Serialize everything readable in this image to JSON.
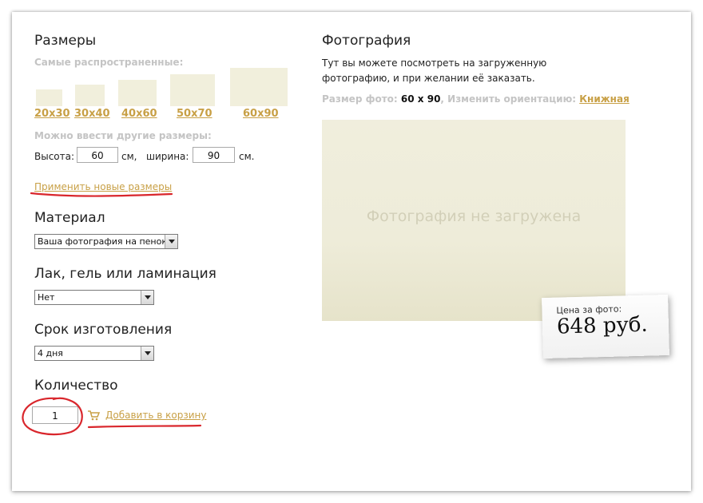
{
  "sizes": {
    "title": "Размеры",
    "common_label": "Самые распространенные:",
    "options": [
      "20x30",
      "30x40",
      "40x60",
      "50x70",
      "60x90"
    ],
    "custom_label": "Можно ввести другие размеры:",
    "height_label": "Высота:",
    "height_value": "60",
    "unit1": "см,",
    "width_label": "ширина:",
    "width_value": "90",
    "unit2": "см.",
    "apply_link": "Применить новые размеры"
  },
  "material": {
    "title": "Материал",
    "selected": "Ваша фотография на пенокартоне"
  },
  "coating": {
    "title": "Лак, гель или ламинация",
    "selected": "Нет"
  },
  "term": {
    "title": "Срок изготовления",
    "selected": "4 дня"
  },
  "quantity": {
    "title": "Количество",
    "value": "1",
    "add_to_cart": "Добавить в корзину"
  },
  "photo": {
    "title": "Фотография",
    "description": "Тут вы можете посмотреть на загруженную фотографию, и при желании её заказать.",
    "size_label": "Размер фото:",
    "size_value": "60 x 90",
    "orientation_label": ", Изменить ориентацию:",
    "orientation_link": "Книжная",
    "placeholder": "Фотография не загружена"
  },
  "price": {
    "label": "Цена за фото:",
    "value": "648 руб."
  },
  "colors": {
    "accent_gold": "#c8a046",
    "annotation_red": "#d9262c",
    "photo_bg": "#f0eedd"
  }
}
